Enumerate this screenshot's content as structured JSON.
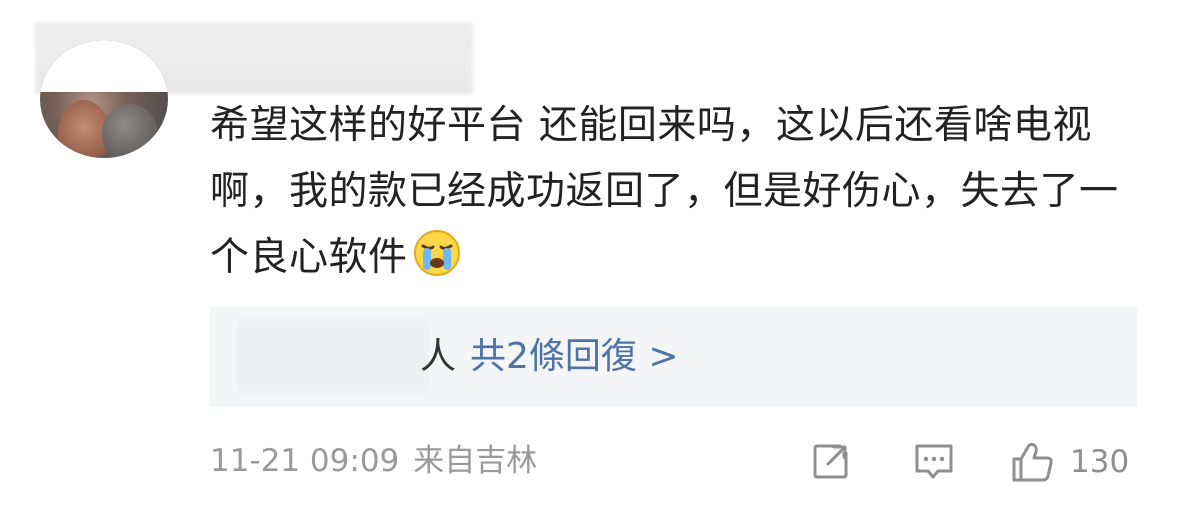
{
  "comment": {
    "text_parts": {
      "before_emoji": "希望这样的好平台 还能回来吗，这以后还看啥电视啊，我的款已经成功返回了，但是好伤心，失去了一个良心软件",
      "emoji": "crying-emoji"
    },
    "replies": {
      "person_suffix": "人",
      "link_label": "共2條回復 >"
    },
    "footer": {
      "time": "11-21 09:09",
      "location": "来自吉林",
      "like_count": "130"
    }
  },
  "icons": {
    "share": "share-icon",
    "reply": "comment-icon",
    "like": "thumbs-up-icon"
  },
  "colors": {
    "text": "#222222",
    "link": "#4f73a6",
    "meta": "#9a9a9a",
    "reply_bg": "#f4f5f7"
  }
}
